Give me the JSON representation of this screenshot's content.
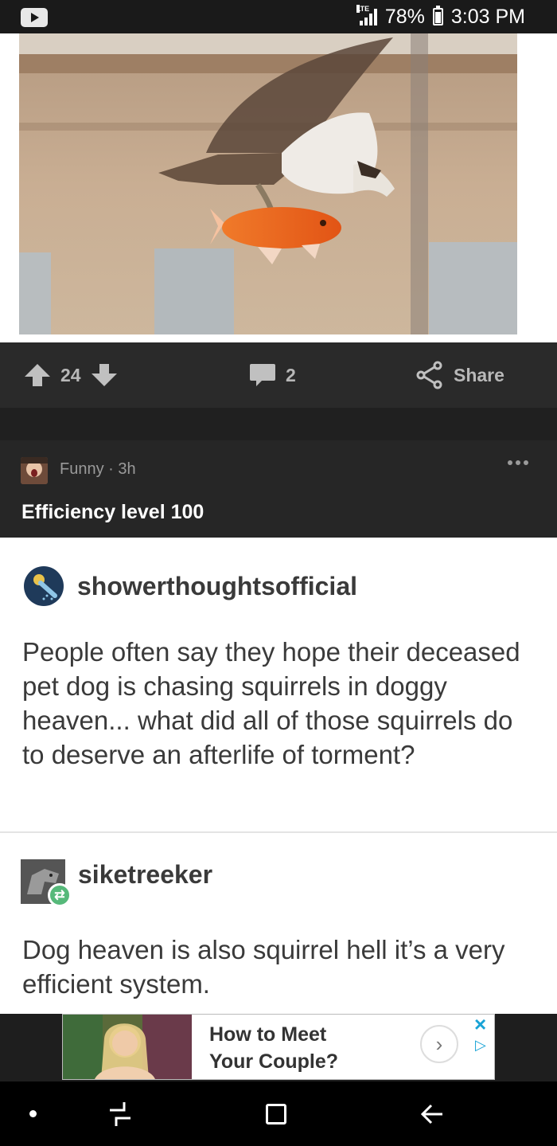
{
  "status_bar": {
    "network": "LTE",
    "battery": "78%",
    "time": "3:03 PM"
  },
  "actions": {
    "upvotes": "24",
    "comments": "2",
    "share_label": "Share"
  },
  "post": {
    "category": "Funny",
    "age": "3h",
    "title": "Efficiency level 100"
  },
  "tumblr": {
    "first_user": "showerthoughtsofficial",
    "first_text": "People often say they hope their deceased pet dog is chasing squirrels in doggy heaven... what did all of those squirrels do to deserve an afterlife of torment?",
    "second_user": "siketreeker",
    "second_text": "Dog heaven is also squirrel hell it’s a very efficient system."
  },
  "ad": {
    "line1": "How to Meet",
    "line2": "Your Couple?",
    "close": "×"
  },
  "colors": {
    "accent": "#19a3d6",
    "dark": "#202020",
    "header": "#262626"
  }
}
